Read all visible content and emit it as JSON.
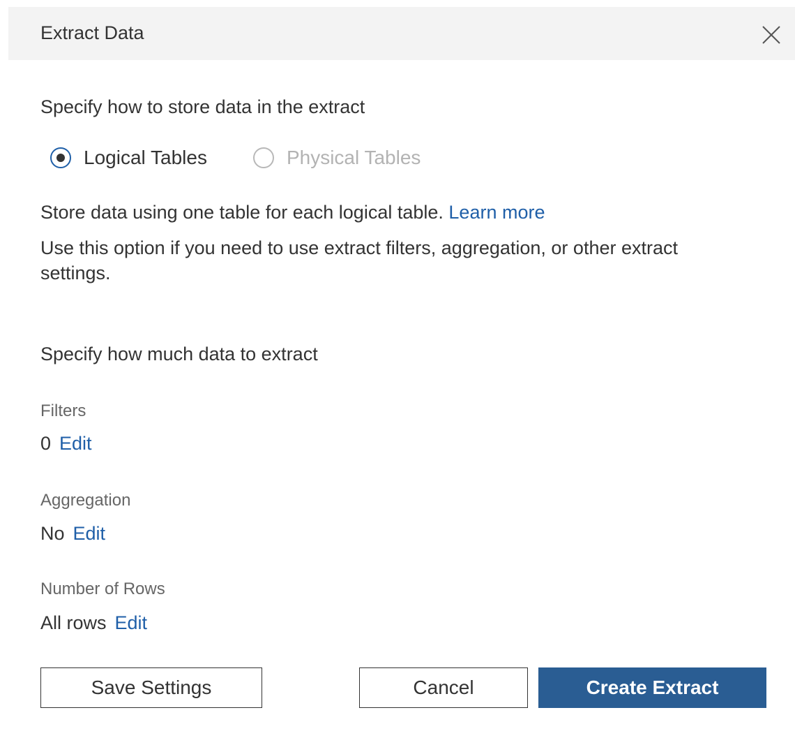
{
  "dialog": {
    "title": "Extract Data",
    "close_icon": "close-icon"
  },
  "storage": {
    "heading": "Specify how to store data in the extract",
    "options": [
      {
        "label": "Logical Tables",
        "selected": true,
        "enabled": true
      },
      {
        "label": "Physical Tables",
        "selected": false,
        "enabled": false
      }
    ],
    "description": "Store data using one table for each logical table.",
    "learn_more": "Learn more",
    "note": "Use this option if you need to use extract filters, aggregation, or other extract settings."
  },
  "amount": {
    "heading": "Specify how much data to extract",
    "filters": {
      "label": "Filters",
      "value": "0",
      "edit": "Edit"
    },
    "aggregation": {
      "label": "Aggregation",
      "value": "No",
      "edit": "Edit"
    },
    "rows": {
      "label": "Number of Rows",
      "value": "All rows",
      "edit": "Edit"
    }
  },
  "buttons": {
    "save": "Save Settings",
    "cancel": "Cancel",
    "create": "Create Extract"
  },
  "colors": {
    "accent": "#1f5fa8",
    "primary_button": "#2a5d93",
    "title_bar": "#f3f3f3"
  }
}
